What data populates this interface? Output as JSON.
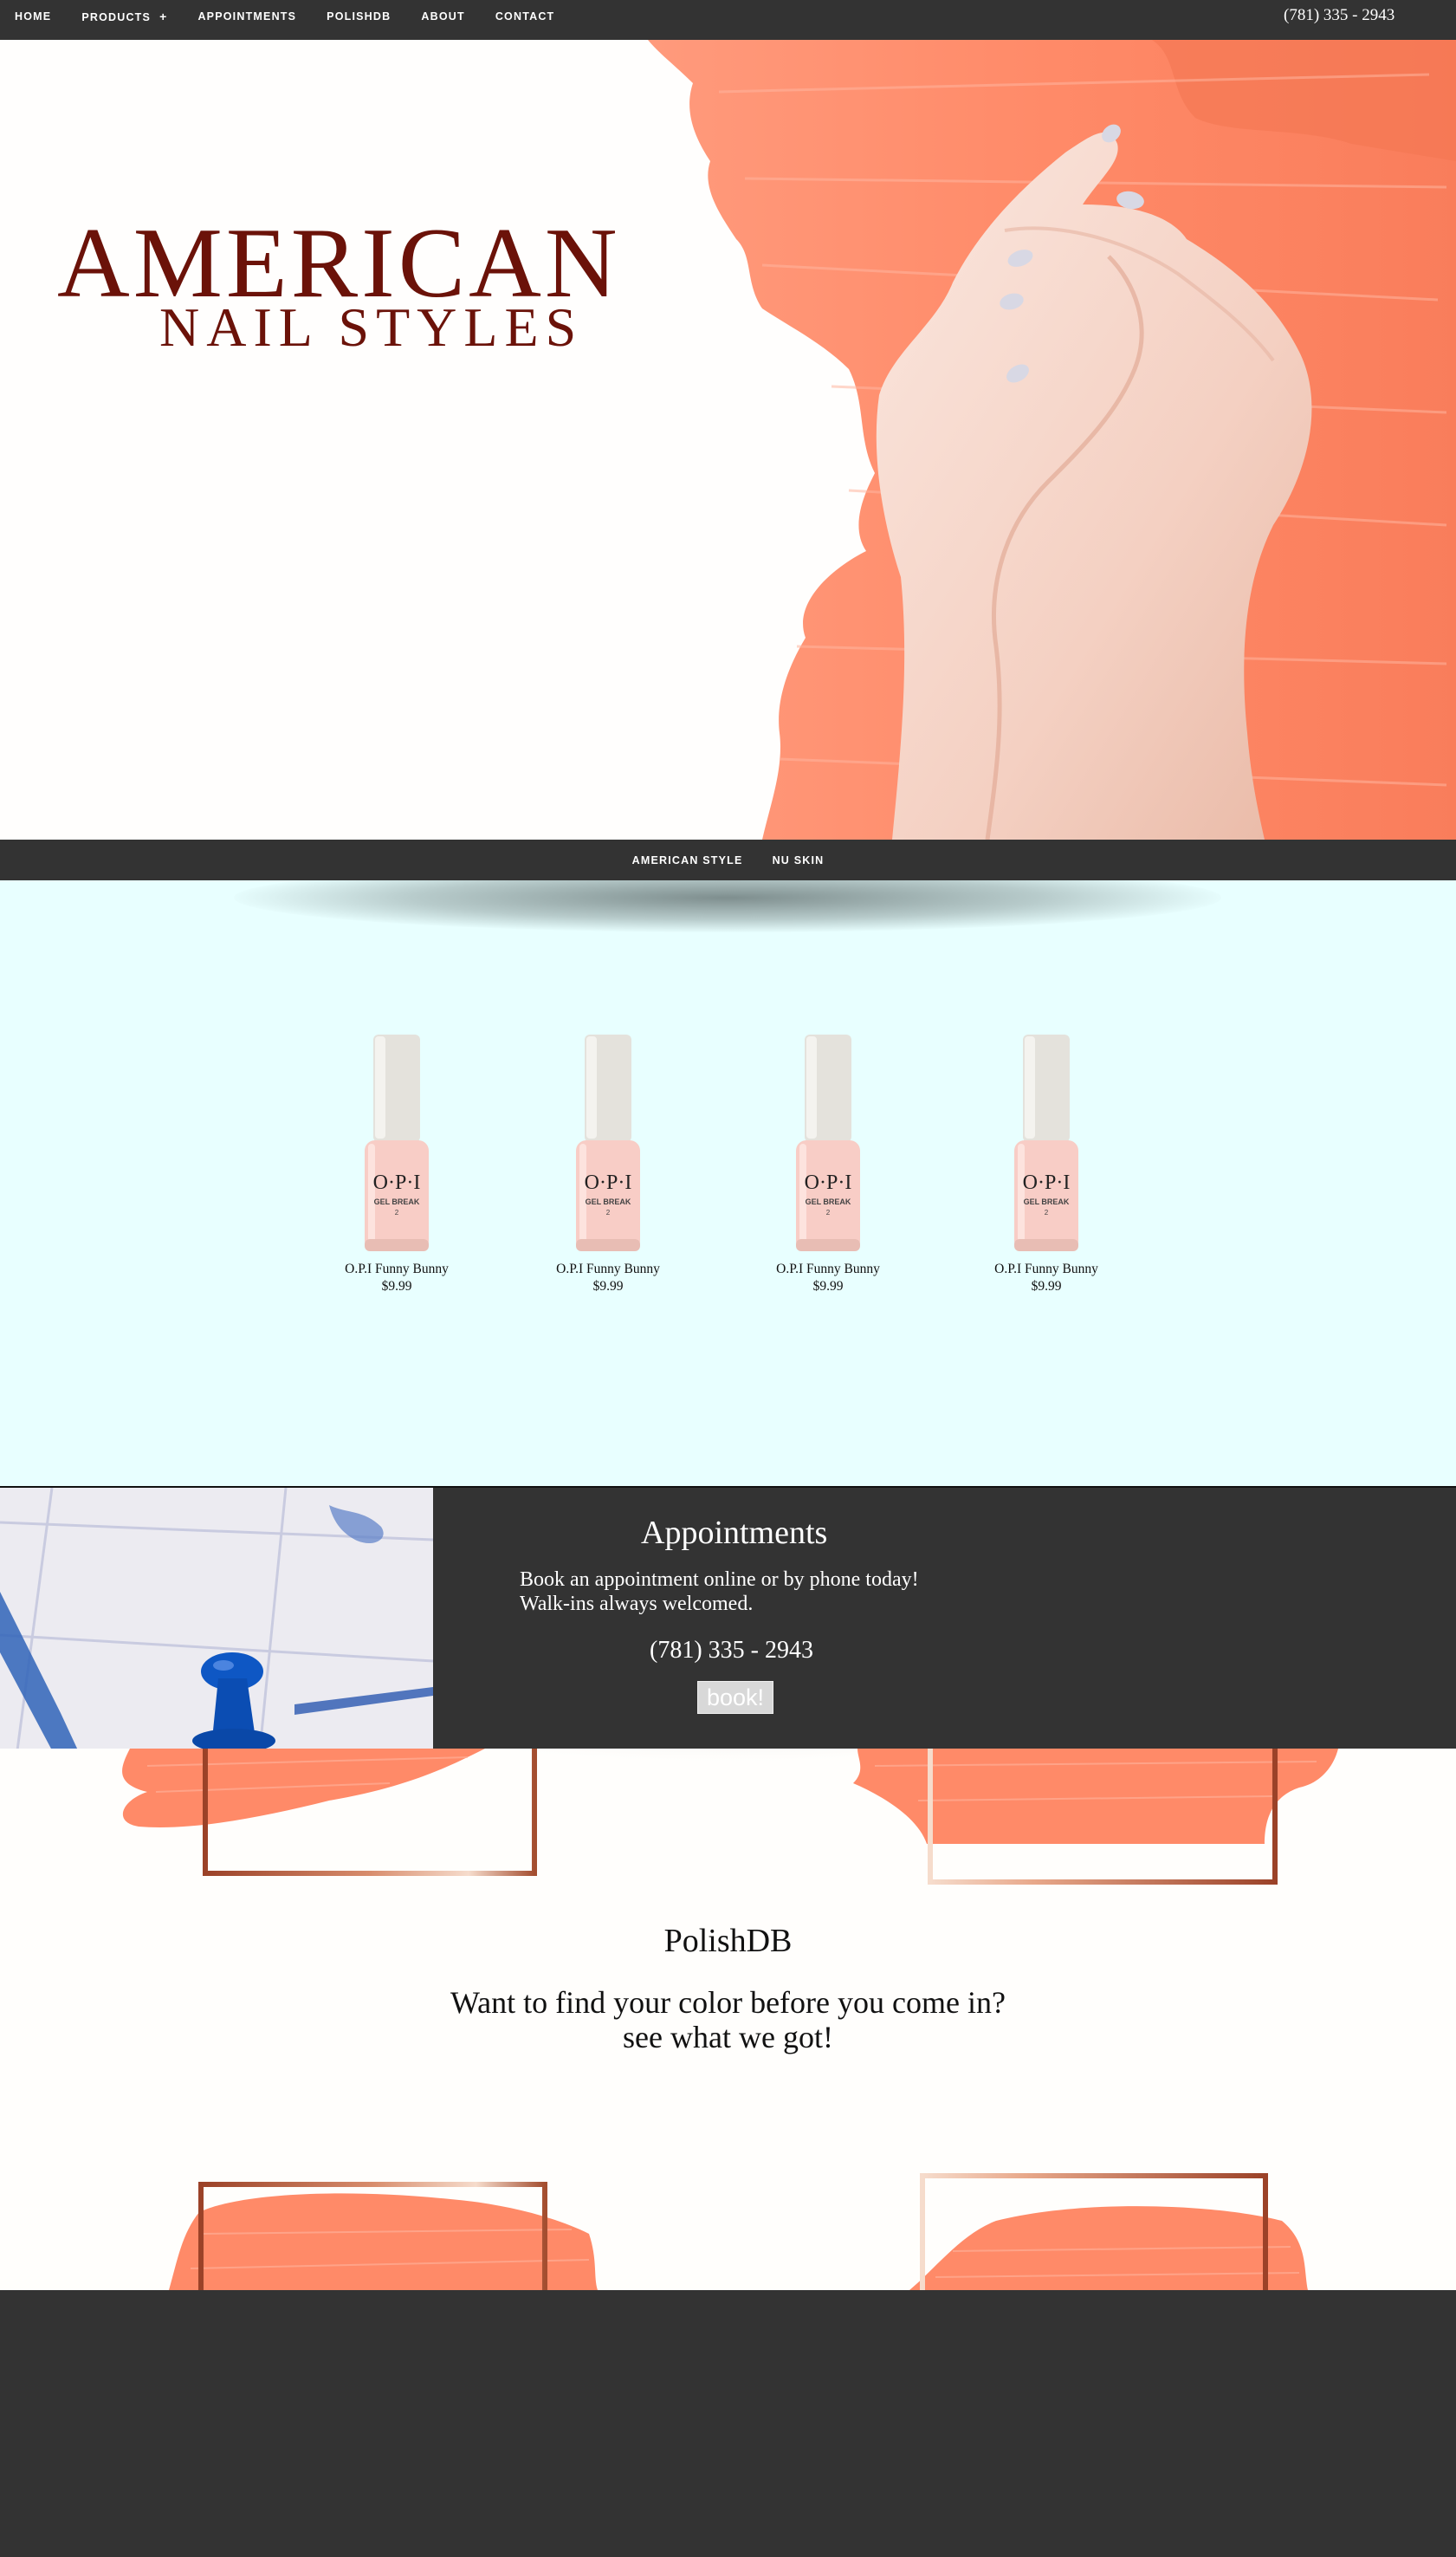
{
  "nav": {
    "items": [
      {
        "label": "HOME"
      },
      {
        "label": "PRODUCTS",
        "has_submenu": true
      },
      {
        "label": "APPOINTMENTS"
      },
      {
        "label": "POLISHDB"
      },
      {
        "label": "ABOUT"
      },
      {
        "label": "CONTACT"
      }
    ],
    "submenu_indicator": "+",
    "phone": "(781) 335 - 2943"
  },
  "hero": {
    "logo_line1": "AMERICAN",
    "logo_line2": "NAIL STYLES",
    "background_color": "#fffefd",
    "accent_color": "#ff8a68"
  },
  "subnav": {
    "items": [
      {
        "label": "AMERICAN STYLE"
      },
      {
        "label": "NU SKIN"
      }
    ]
  },
  "products": {
    "background_color": "#e8ffff",
    "bottle_brand_text": "O·P·I",
    "bottle_line_text": "GEL BREAK",
    "bottle_step_text": "2",
    "items": [
      {
        "name": "O.P.I Funny Bunny",
        "price": "$9.99"
      },
      {
        "name": "O.P.I Funny Bunny",
        "price": "$9.99"
      },
      {
        "name": "O.P.I Funny Bunny",
        "price": "$9.99"
      },
      {
        "name": "O.P.I Funny Bunny",
        "price": "$9.99"
      }
    ]
  },
  "appointments": {
    "title": "Appointments",
    "line1": "Book an appointment online or by phone today!",
    "line2": "Walk-ins always welcomed.",
    "phone": "(781) 335 - 2943",
    "book_label": "book!"
  },
  "polishdb": {
    "title": "PolishDB",
    "line1": "Want to find your color before you come in?",
    "line2": "see what we got!"
  },
  "colors": {
    "dark_bar": "#333333",
    "brand_red": "#6b1209",
    "coral": "#ff8a68",
    "copper": "#a0482c"
  }
}
